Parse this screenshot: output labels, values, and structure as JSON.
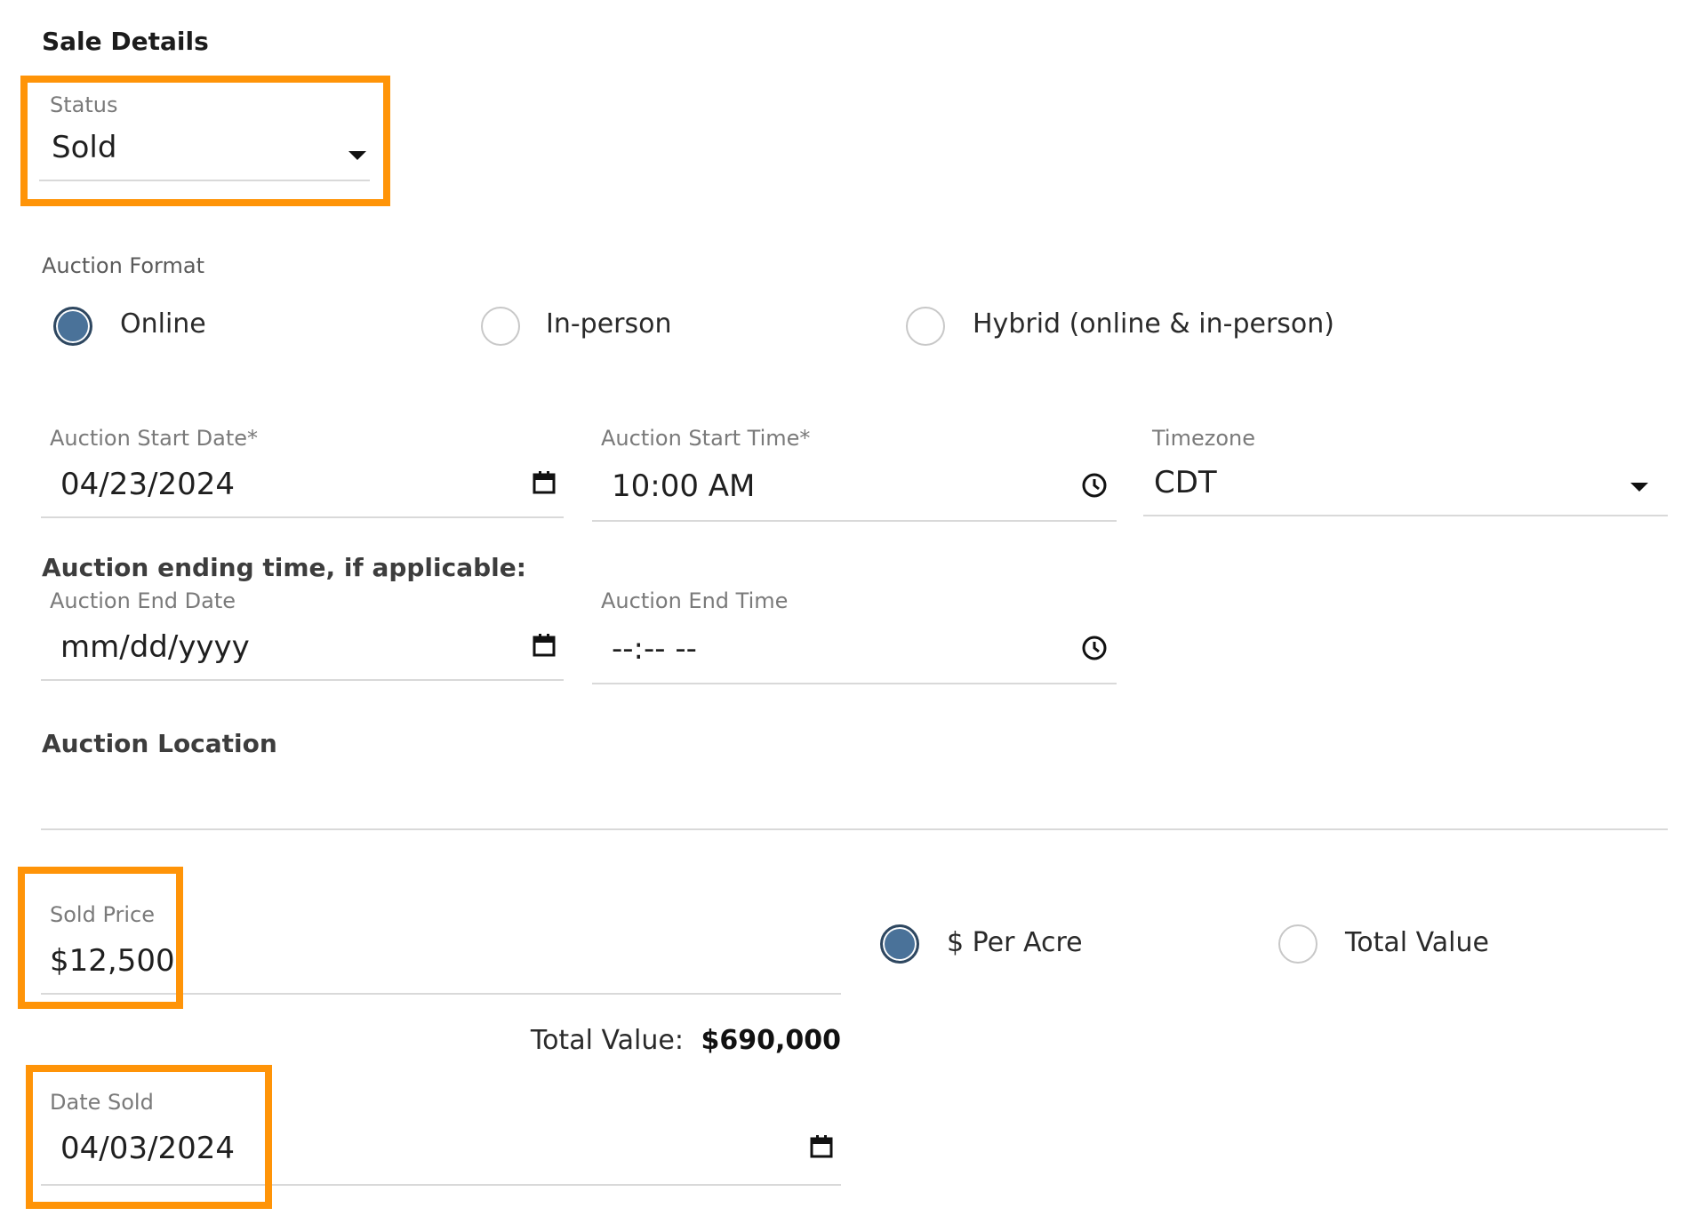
{
  "section_title": "Sale Details",
  "status": {
    "label": "Status",
    "value": "Sold"
  },
  "auction_format": {
    "label": "Auction Format",
    "options": [
      "Online",
      "In-person",
      "Hybrid (online & in-person)"
    ],
    "selected": "Online"
  },
  "auction_start_date": {
    "label": "Auction Start Date*",
    "value": "04/23/2024"
  },
  "auction_start_time": {
    "label": "Auction Start Time*",
    "value": "10:00 AM"
  },
  "timezone": {
    "label": "Timezone",
    "value": "CDT"
  },
  "auction_end": {
    "heading": "Auction ending time, if applicable:",
    "date_label": "Auction End Date",
    "date_placeholder": "mm/dd/yyyy",
    "time_label": "Auction End Time",
    "time_placeholder": "--:-- --"
  },
  "auction_location": {
    "label": "Auction Location",
    "value": ""
  },
  "sold_price": {
    "label": "Sold Price",
    "value": "$12,500"
  },
  "price_basis": {
    "options": [
      "$ Per Acre",
      "Total Value"
    ],
    "selected": "$ Per Acre"
  },
  "total_value": {
    "label": "Total Value:",
    "value": "$690,000"
  },
  "date_sold": {
    "label": "Date Sold",
    "value": "04/03/2024"
  },
  "icons": [
    "calendar-icon",
    "clock-icon",
    "caret-down-icon"
  ],
  "colors": {
    "highlight": "#ff9408",
    "radio_selected": "#4a7299"
  }
}
